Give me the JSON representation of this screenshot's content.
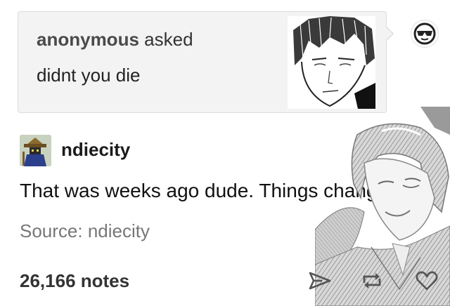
{
  "ask": {
    "asker_name": "anonymous",
    "asked_label": "asked",
    "question": "didnt you die",
    "asker_avatar_icon": "sunglasses-face-icon",
    "illustration": "manga-character-portrait"
  },
  "post": {
    "username": "ndiecity",
    "avatar_icon": "pixel-art-mage-avatar",
    "body": "That was weeks ago dude. Things change",
    "source": "Source: ndiecity",
    "notes": "26,166 notes",
    "illustration": "manga-character-winking"
  },
  "actions": [
    {
      "icon": "share-icon"
    },
    {
      "icon": "reblog-icon"
    },
    {
      "icon": "heart-icon"
    }
  ],
  "colors": {
    "ask_background": "#f3f3f3",
    "text": "#1a1a1a",
    "source_text": "#777777",
    "icon_gray": "#555555"
  }
}
